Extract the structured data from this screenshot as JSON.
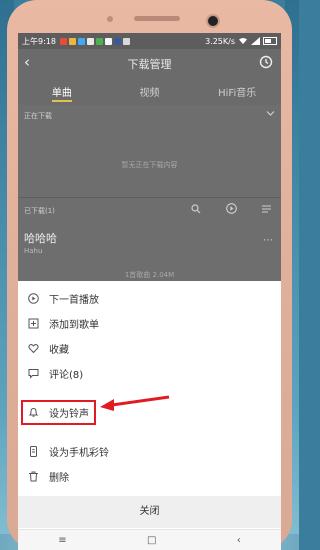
{
  "statusbar": {
    "time": "上午9:18",
    "speed": "3.25K/s",
    "battery": ""
  },
  "appbar": {
    "title": "下载管理"
  },
  "tabs": [
    {
      "label": "单曲"
    },
    {
      "label": "视频"
    },
    {
      "label": "HiFi音乐"
    }
  ],
  "downloading": {
    "header": "正在下载",
    "empty_text": "暂无正在下载内容"
  },
  "downloaded": {
    "header": "已下载(1)",
    "song_title": "哈哈哈",
    "song_artist": "Hahu",
    "storage": "1首歌曲 2.04M"
  },
  "menu": {
    "items": [
      {
        "label": "下一首播放",
        "icon": "play-next-icon"
      },
      {
        "label": "添加到歌单",
        "icon": "add-playlist-icon"
      },
      {
        "label": "收藏",
        "icon": "heart-icon"
      },
      {
        "label": "评论(8)",
        "icon": "comment-icon"
      },
      {
        "label": "设为铃声",
        "icon": "bell-icon"
      },
      {
        "label": "设为手机彩铃",
        "icon": "phone-ringback-icon"
      },
      {
        "label": "删除",
        "icon": "trash-icon"
      }
    ],
    "close_label": "关闭"
  },
  "colors": {
    "accent": "#e0c34a",
    "highlight": "#e21b23"
  }
}
